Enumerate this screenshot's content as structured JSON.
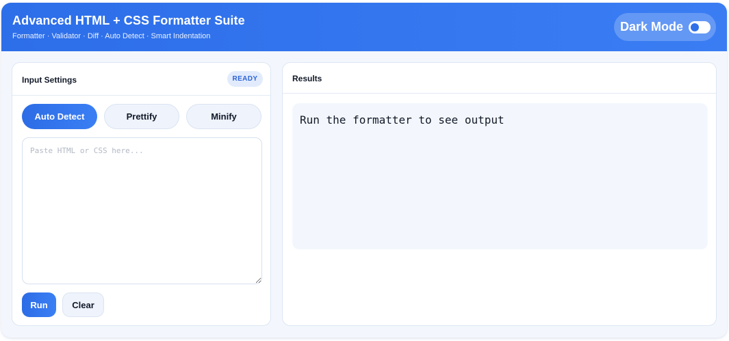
{
  "header": {
    "title": "Advanced HTML + CSS Formatter Suite",
    "subtitle": "Formatter · Validator · Diff · Auto Detect · Smart Indentation",
    "dark_mode_label": "Dark Mode",
    "dark_mode_on": false
  },
  "input_panel": {
    "title": "Input Settings",
    "status_badge": "READY",
    "modes": [
      {
        "label": "Auto Detect",
        "active": true
      },
      {
        "label": "Prettify",
        "active": false
      },
      {
        "label": "Minify",
        "active": false
      }
    ],
    "input_placeholder": "Paste HTML or CSS here...",
    "input_value": "",
    "run_label": "Run",
    "clear_label": "Clear"
  },
  "results_panel": {
    "title": "Results",
    "output_text": "Run the formatter to see output"
  },
  "colors": {
    "accent": "#2f6fe8",
    "header_gradient_start": "#2d6ee9",
    "header_gradient_end": "#3a7df3",
    "app_background": "#f3f7fd",
    "badge_background": "#e1ebfc",
    "badge_text": "#2d63d6"
  },
  "icons": {
    "dark_mode_toggle": "toggle-switch-icon"
  }
}
